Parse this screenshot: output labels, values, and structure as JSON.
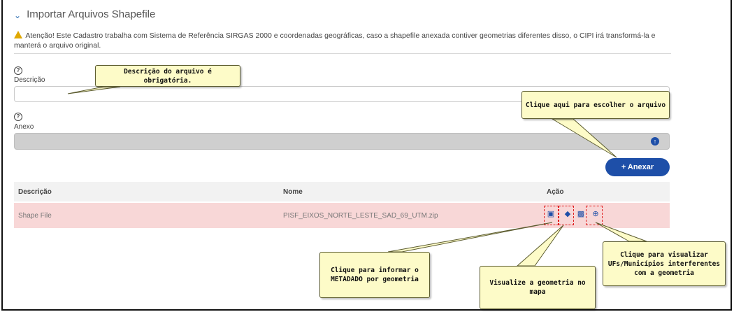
{
  "panel": {
    "title": "Importar Arquivos Shapefile"
  },
  "warning_text": "Atenção! Este Cadastro trabalha com Sistema de Referência SIRGAS 2000 e coordenadas geográficas, caso a shapefile anexada contiver geometrias diferentes disso, o CIPI irá transformá-la e manterá o arquivo original.",
  "form": {
    "description_label": "Descrição",
    "description_value": "",
    "attachment_label": "Anexo",
    "attach_button": "+ Anexar"
  },
  "table": {
    "columns": [
      "Descrição",
      "Nome",
      "Ação"
    ],
    "rows": [
      {
        "descricao": "Shape File",
        "nome": "PISF_EIXOS_NORTE_LESTE_SAD_69_UTM.zip"
      }
    ]
  },
  "callouts": {
    "description_required": "Descrição do arquivo é obrigatória.",
    "choose_file": "Clique aqui para escolher o arquivo",
    "metadata": "Clique para informar o METADADO por geometria",
    "view_geometry": "Visualize a geometria no mapa",
    "view_ufs": "Clique para visualizar UFs/Municípios interferentes com a geometria"
  },
  "icons": {
    "collapse": "chevron-down-icon",
    "warning": "warning-icon",
    "help": "help-icon",
    "upload": "upload-icon",
    "metadata": "document-icon",
    "map": "map-icon",
    "delete": "trash-icon",
    "search": "zoom-icon"
  },
  "colors": {
    "primary": "#1e4fa8",
    "row_highlight": "#f8d7d7",
    "callout_bg": "#fdfbc8",
    "highlight_border": "#e02020"
  }
}
